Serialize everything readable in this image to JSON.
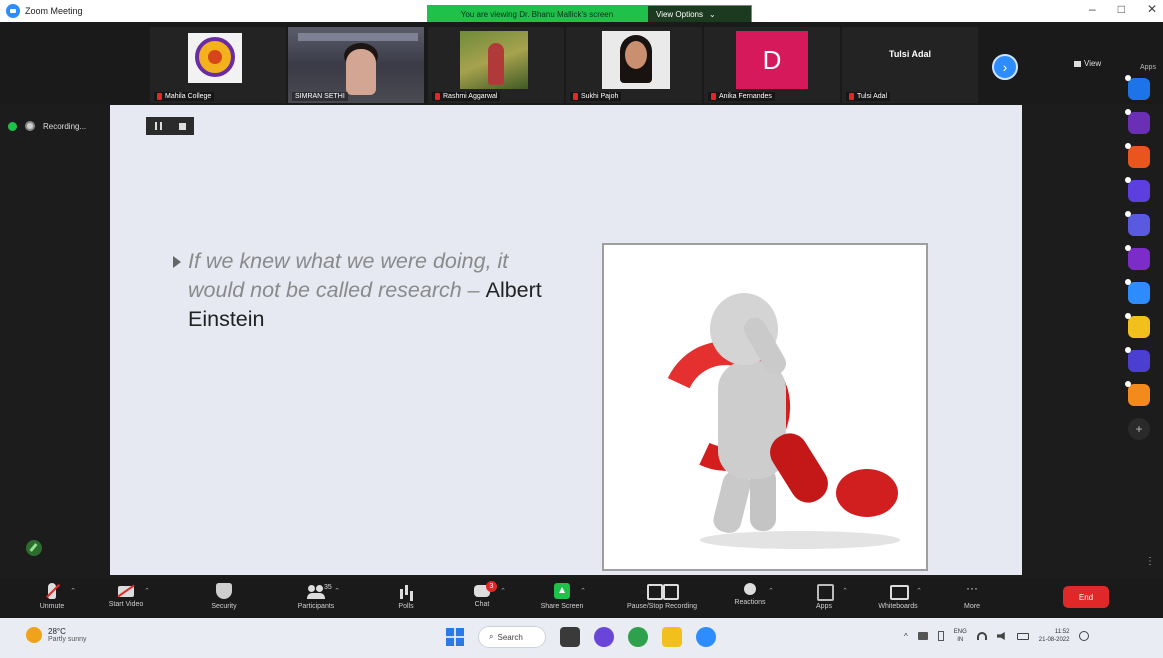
{
  "window": {
    "title": "Zoom Meeting"
  },
  "share_banner": {
    "text": "You are viewing Dr. Bhanu Mallick's screen",
    "view_options": "View Options",
    "caret": "⌄"
  },
  "window_controls": [
    "–",
    "□",
    "✕"
  ],
  "participants": [
    {
      "name": "Mahila College"
    },
    {
      "name": "SIMRAN SETHI"
    },
    {
      "name": "Rashmi Aggarwal"
    },
    {
      "name": "Sukhi Pajoh"
    },
    {
      "name": "Anika Fernandes",
      "initial": "D"
    },
    {
      "name": "Tulsi Adal",
      "display_name": "Tulsi Adal"
    }
  ],
  "view_button": "View",
  "apps_label": "Apps",
  "next_arrow": "›",
  "recording": {
    "label": "Recording..."
  },
  "slide": {
    "quote_italic": "If we knew what we were doing, it would not be called research",
    "dash": " – ",
    "author": "Albert Einstein"
  },
  "side_apps": [
    {
      "name": "app-blue",
      "color": "#1d74e8"
    },
    {
      "name": "app-mural",
      "color": "#6b2fb5"
    },
    {
      "name": "app-orange",
      "color": "#e8561d"
    },
    {
      "name": "app-vk",
      "color": "#5d3fe0"
    },
    {
      "name": "app-purple",
      "color": "#5a5ae0"
    },
    {
      "name": "app-violet",
      "color": "#7b2cc9"
    },
    {
      "name": "app-chat",
      "color": "#2d8cff"
    },
    {
      "name": "app-yellow",
      "color": "#f2c01c"
    },
    {
      "name": "app-indigo",
      "color": "#4b3fd1"
    },
    {
      "name": "app-grid",
      "color": "#f28a1c"
    }
  ],
  "rail": {
    "add": "+",
    "dots": "⋮"
  },
  "toolbar": {
    "unmute": "Unmute",
    "start_video": "Start Video",
    "security": "Security",
    "participants": "Participants",
    "participant_count": "35",
    "polls": "Polls",
    "chat": "Chat",
    "chat_badge": "3",
    "share_screen": "Share Screen",
    "pause_recording": "Pause/Stop Recording",
    "reactions": "Reactions",
    "apps": "Apps",
    "whiteboards": "Whiteboards",
    "more": "More",
    "more_glyph": "···",
    "end": "End",
    "caret": "⌃"
  },
  "taskbar": {
    "weather_temp": "28°C",
    "weather_desc": "Partly sunny",
    "search": "Search",
    "lang_top": "ENG",
    "lang_bottom": "IN",
    "time": "11:52",
    "date": "21-08-2022",
    "tray_caret": "^"
  },
  "colors": {
    "zoom_blue": "#2d8cff",
    "share_green": "#1fc14b",
    "end_red": "#e02828",
    "slide_bg": "#e6e9f2",
    "question_red": "#d41d1d"
  }
}
